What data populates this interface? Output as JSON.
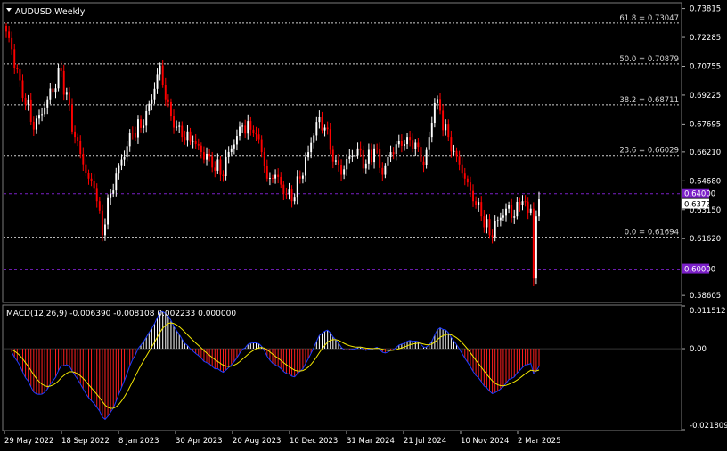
{
  "chart_data": [
    {
      "type": "candlestick",
      "title": "AUDUSD,Weekly",
      "symbol": "AUDUSD",
      "timeframe": "Weekly",
      "ylim": [
        0.58282,
        0.74079
      ],
      "price_ticks": [
        "0.73815",
        "0.72285",
        "0.70755",
        "0.69225",
        "0.67695",
        "0.66210",
        "0.64680",
        "0.63150",
        "0.61620",
        "0.58605"
      ],
      "x_tick_labels": [
        "29 May 2022",
        "18 Sep 2022",
        "8 Jan 2023",
        "30 Apr 2023",
        "20 Aug 2023",
        "10 Dec 2023",
        "31 Mar 2024",
        "21 Jul 2024",
        "10 Nov 2024",
        "2 Mar 2025"
      ],
      "current_price_label": "0.63725",
      "fibonacci_levels": [
        {
          "label": "61.8 = 0.73047",
          "value": 0.73047
        },
        {
          "label": "50.0 = 0.70879",
          "value": 0.70879
        },
        {
          "label": "38.2 = 0.68711",
          "value": 0.68711
        },
        {
          "label": "23.6 = 0.66029",
          "value": 0.66029
        },
        {
          "label": "0.0 = 0.61694",
          "value": 0.61694
        }
      ],
      "horizontal_lines": [
        {
          "label": "0.64000",
          "value": 0.64,
          "color": "#7b1fc8"
        },
        {
          "label": "0.60000",
          "value": 0.6,
          "color": "#7b1fc8"
        }
      ],
      "anchors": [
        {
          "i": 0,
          "close": 0.726
        },
        {
          "i": 5,
          "close": 0.7
        },
        {
          "i": 10,
          "close": 0.674
        },
        {
          "i": 15,
          "close": 0.69
        },
        {
          "i": 20,
          "close": 0.705
        },
        {
          "i": 25,
          "close": 0.67
        },
        {
          "i": 30,
          "close": 0.648
        },
        {
          "i": 32,
          "close": 0.643
        },
        {
          "i": 35,
          "close": 0.618
        },
        {
          "i": 38,
          "close": 0.64
        },
        {
          "i": 42,
          "close": 0.658
        },
        {
          "i": 46,
          "close": 0.672
        },
        {
          "i": 50,
          "close": 0.676
        },
        {
          "i": 53,
          "close": 0.69
        },
        {
          "i": 56,
          "close": 0.708
        },
        {
          "i": 58,
          "close": 0.69
        },
        {
          "i": 61,
          "close": 0.675
        },
        {
          "i": 64,
          "close": 0.67
        },
        {
          "i": 68,
          "close": 0.668
        },
        {
          "i": 71,
          "close": 0.662
        },
        {
          "i": 74,
          "close": 0.66
        },
        {
          "i": 78,
          "close": 0.65
        },
        {
          "i": 82,
          "close": 0.664
        },
        {
          "i": 86,
          "close": 0.676
        },
        {
          "i": 90,
          "close": 0.672
        },
        {
          "i": 93,
          "close": 0.662
        },
        {
          "i": 95,
          "close": 0.648
        },
        {
          "i": 98,
          "close": 0.65
        },
        {
          "i": 101,
          "close": 0.64
        },
        {
          "i": 104,
          "close": 0.636
        },
        {
          "i": 107,
          "close": 0.648
        },
        {
          "i": 110,
          "close": 0.662
        },
        {
          "i": 113,
          "close": 0.678
        },
        {
          "i": 116,
          "close": 0.675
        },
        {
          "i": 119,
          "close": 0.657
        },
        {
          "i": 122,
          "close": 0.65
        },
        {
          "i": 125,
          "close": 0.66
        },
        {
          "i": 128,
          "close": 0.664
        },
        {
          "i": 131,
          "close": 0.656
        },
        {
          "i": 134,
          "close": 0.664
        },
        {
          "i": 137,
          "close": 0.65
        },
        {
          "i": 140,
          "close": 0.662
        },
        {
          "i": 143,
          "close": 0.668
        },
        {
          "i": 146,
          "close": 0.67
        },
        {
          "i": 149,
          "close": 0.667
        },
        {
          "i": 152,
          "close": 0.655
        },
        {
          "i": 154,
          "close": 0.67
        },
        {
          "i": 156,
          "close": 0.688
        },
        {
          "i": 158,
          "close": 0.684
        },
        {
          "i": 161,
          "close": 0.67
        },
        {
          "i": 164,
          "close": 0.66
        },
        {
          "i": 167,
          "close": 0.648
        },
        {
          "i": 170,
          "close": 0.636
        },
        {
          "i": 173,
          "close": 0.628
        },
        {
          "i": 176,
          "close": 0.618
        },
        {
          "i": 179,
          "close": 0.626
        },
        {
          "i": 182,
          "close": 0.632
        },
        {
          "i": 185,
          "close": 0.628
        },
        {
          "i": 188,
          "close": 0.636
        },
        {
          "i": 190,
          "close": 0.63
        },
        {
          "i": 191,
          "close": 0.632
        },
        {
          "i": 192,
          "close": 0.595
        },
        {
          "i": 193,
          "close": 0.628
        },
        {
          "i": 194,
          "close": 0.637
        }
      ],
      "bars_count": 195,
      "colors": {
        "up": "#ffffff",
        "down": "#ff0000",
        "background": "#000000",
        "grid_label": "#ffffff"
      }
    },
    {
      "type": "macd",
      "title": "MACD(12,26,9) -0.006390 -0.008108 0.002233 0.000000",
      "params": "12,26,9",
      "values": {
        "main": -0.00639,
        "signal": -0.008108,
        "histogram": 0.002233,
        "extra": 0.0
      },
      "ylim": [
        -0.021809,
        0.011512
      ],
      "y_ticks": [
        "0.011512",
        "0.00",
        "-0.021809"
      ],
      "colors": {
        "hist_up": "#ffffff",
        "hist_down": "#ff2020",
        "macd": "#1e3cff",
        "signal": "#f2e600"
      }
    }
  ]
}
